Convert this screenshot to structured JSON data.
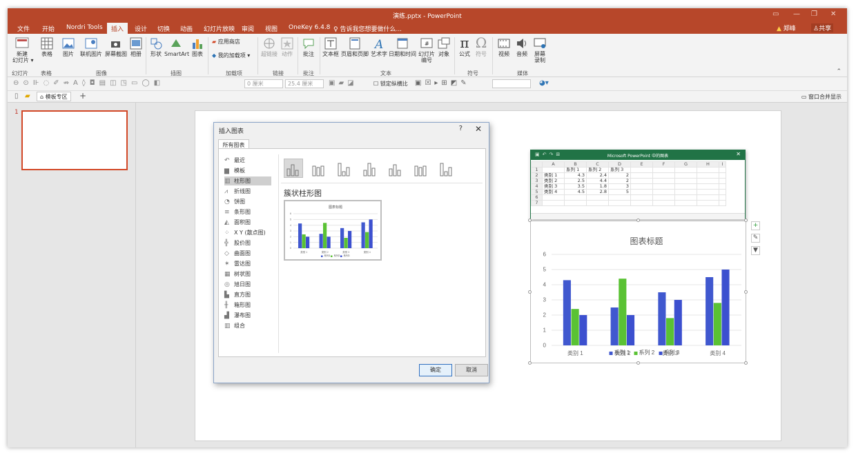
{
  "window": {
    "title": "演练.pptx - PowerPoint",
    "controls": [
      "▭",
      "—",
      "❐",
      "✕"
    ]
  },
  "ribbon_tabs": [
    "文件",
    "开始",
    "Nordri Tools",
    "插入",
    "设计",
    "切换",
    "动画",
    "幻灯片放映",
    "审阅",
    "视图",
    "OneKey 6.4.8"
  ],
  "active_tab": "插入",
  "tell_me": "告诉我您想要做什么...",
  "user": {
    "warning_name": "郑峰",
    "share": "共享"
  },
  "ribbon": {
    "new_slide": "新建\n幻灯片 ▾",
    "table": "表格",
    "picture": "图片",
    "online_picture": "联机图片",
    "screenshot": "屏幕截图",
    "album": "相册",
    "shapes": "形状",
    "smartart": "SmartArt",
    "chart": "图表",
    "store": "应用商店",
    "my_addins": "我的加载项",
    "hyperlink": "超链接",
    "action": "动作",
    "comment": "批注",
    "textbox": "文本框",
    "header_footer": "页眉和页脚",
    "wordart": "艺术字",
    "datetime": "日期和时间",
    "slide_number": "幻灯片\n编号",
    "object": "对象",
    "equation": "公式",
    "symbol": "符号",
    "video": "视频",
    "audio": "音频",
    "screen_record": "屏幕\n录制",
    "groups": [
      "幻灯片",
      "表格",
      "图像",
      "插图",
      "加载项",
      "链接",
      "批注",
      "文本",
      "符号",
      "媒体"
    ]
  },
  "quickbar": {
    "width_value": "0 厘米",
    "height_value": "25.4 厘米",
    "lock_ratio": "锁定纵横比"
  },
  "doc_tabs": {
    "template_tab": "模板专区",
    "merge_windows": "窗口合并显示"
  },
  "slide_panel": {
    "number": "1"
  },
  "dialog": {
    "title": "插入图表",
    "help": "?",
    "close": "✕",
    "tab": "所有图表",
    "categories": [
      "最近",
      "模板",
      "柱形图",
      "折线图",
      "饼图",
      "条形图",
      "面积图",
      "X Y (散点图)",
      "股价图",
      "曲面图",
      "雷达图",
      "树状图",
      "旭日图",
      "直方图",
      "箱形图",
      "瀑布图",
      "组合"
    ],
    "category_icons": [
      "↶",
      "▆",
      "▥",
      "⩘",
      "◔",
      "≡",
      "◭",
      "⁘",
      "╬",
      "◇",
      "✶",
      "▦",
      "◎",
      "▙",
      "╫",
      "▟",
      "▥"
    ],
    "selected_category": "柱形图",
    "selected_type_name": "簇状柱形图",
    "ok": "确定",
    "cancel": "取消",
    "preview": {
      "title": "图表标题",
      "categories": [
        "类别 1",
        "类别 2",
        "类别 3",
        "类别 4"
      ],
      "series": [
        "系列1",
        "系列2",
        "系列3"
      ],
      "y_ticks": [
        "6",
        "5",
        "4",
        "3",
        "2",
        "1",
        "0"
      ]
    }
  },
  "excel": {
    "title": "Microsoft PowerPoint 中的图表",
    "close": "✕",
    "col_headers": [
      "",
      "A",
      "B",
      "C",
      "D",
      "E",
      "F",
      "G",
      "H",
      "I"
    ],
    "rows": [
      [
        "1",
        "",
        "系列 1",
        "系列 2",
        "系列 3",
        "",
        "",
        "",
        "",
        ""
      ],
      [
        "2",
        "类别 1",
        "4.3",
        "2.4",
        "2",
        "",
        "",
        "",
        "",
        ""
      ],
      [
        "3",
        "类别 2",
        "2.5",
        "4.4",
        "2",
        "",
        "",
        "",
        "",
        ""
      ],
      [
        "4",
        "类别 3",
        "3.5",
        "1.8",
        "3",
        "",
        "",
        "",
        "",
        ""
      ],
      [
        "5",
        "类别 4",
        "4.5",
        "2.8",
        "5",
        "",
        "",
        "",
        "",
        ""
      ],
      [
        "6",
        "",
        "",
        "",
        "",
        "",
        "",
        "",
        "",
        ""
      ],
      [
        "7",
        "",
        "",
        "",
        "",
        "",
        "",
        "",
        "",
        ""
      ]
    ]
  },
  "chart_side_buttons": [
    "+",
    "✎",
    "▼"
  ],
  "chart_data": {
    "type": "bar",
    "title": "图表标题",
    "categories": [
      "类别 1",
      "类别 2",
      "类别 3",
      "类别 4"
    ],
    "series": [
      {
        "name": "系列 1",
        "values": [
          4.3,
          2.5,
          3.5,
          4.5
        ],
        "color": "#4058cf"
      },
      {
        "name": "系列 2",
        "values": [
          2.4,
          4.4,
          1.8,
          2.8
        ],
        "color": "#5ac234"
      },
      {
        "name": "系列 3",
        "values": [
          2,
          2,
          3,
          5
        ],
        "color": "#3c50cf"
      }
    ],
    "ylim": [
      0,
      6
    ],
    "y_ticks": [
      0,
      1,
      2,
      3,
      4,
      5,
      6
    ],
    "grid": true,
    "legend": "bottom",
    "xlabel": "",
    "ylabel": ""
  }
}
